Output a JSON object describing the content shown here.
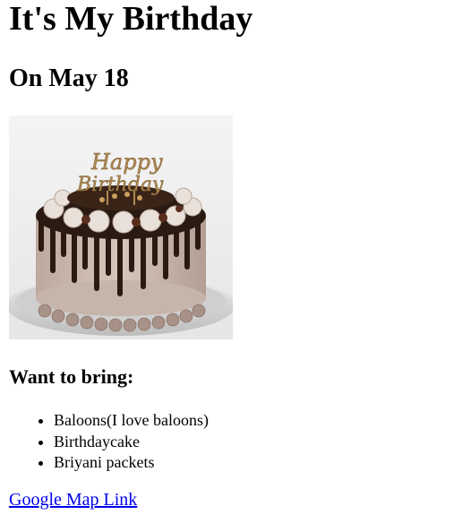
{
  "heading": "It's My Birthday",
  "date_heading": "On May 18",
  "image": {
    "topper_text": [
      "Happy",
      "Birthday"
    ],
    "colors": {
      "cake_base": "#c9b7ad",
      "ganache": "#2a1a12",
      "plate": "#d8d8d8",
      "topper": "#b08a55"
    }
  },
  "bring_heading": "Want to bring:",
  "bring_items": [
    "Baloons(I love baloons)",
    "Birthdaycake",
    "Briyani packets"
  ],
  "map_link": "Google Map Link",
  "link_color": "#0000ee"
}
